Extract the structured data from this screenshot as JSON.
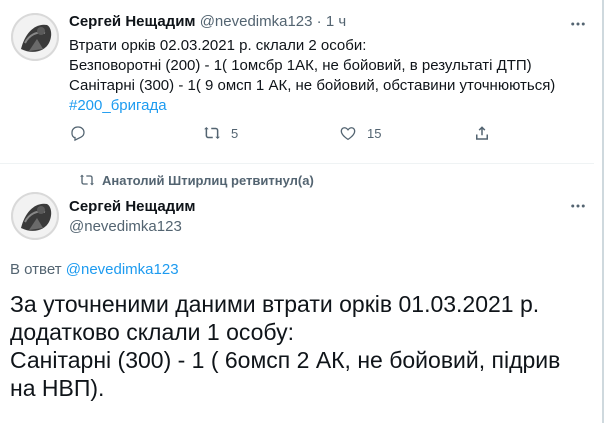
{
  "tweet1": {
    "author_name": "Сергей Нещадим",
    "handle": "@nevedimka123",
    "separator": "·",
    "time": "1 ч",
    "lines": [
      "Втрати орків 02.03.2021 р. склали 2 особи:",
      "Безповоротні (200) - 1( 1омсбр 1АК, не  бойовий, в результаті ДТП)",
      "Санітарні (300) - 1( 9 омсп 1 АК, не  бойовий, обставини уточнюються)"
    ],
    "hashtag": "#200_бригада",
    "actions": {
      "reply_count": "",
      "retweet_count": "5",
      "like_count": "15"
    }
  },
  "retweet_banner": {
    "text": "Анатолий Штирлиц ретвитнул(а)"
  },
  "tweet2": {
    "author_name": "Сергей Нещадим",
    "handle": "@nevedimka123",
    "reply_prefix": "В ответ",
    "reply_handle": "@nevedimka123",
    "lines": [
      "За уточненими даними втрати орків 01.03.2021 р.",
      "додатково склали 1 особу:",
      "Санітарні (300) -  1 ( 6омсп 2 АК, не  бойовий, підрив",
      "на НВП)."
    ]
  },
  "icons": [
    "avatar",
    "more-icon",
    "reply-icon",
    "retweet-icon",
    "like-icon",
    "share-icon"
  ],
  "colors": {
    "text": "#0f1419",
    "muted": "#536471",
    "link": "#1d9bf0",
    "divider": "#eff3f4"
  }
}
